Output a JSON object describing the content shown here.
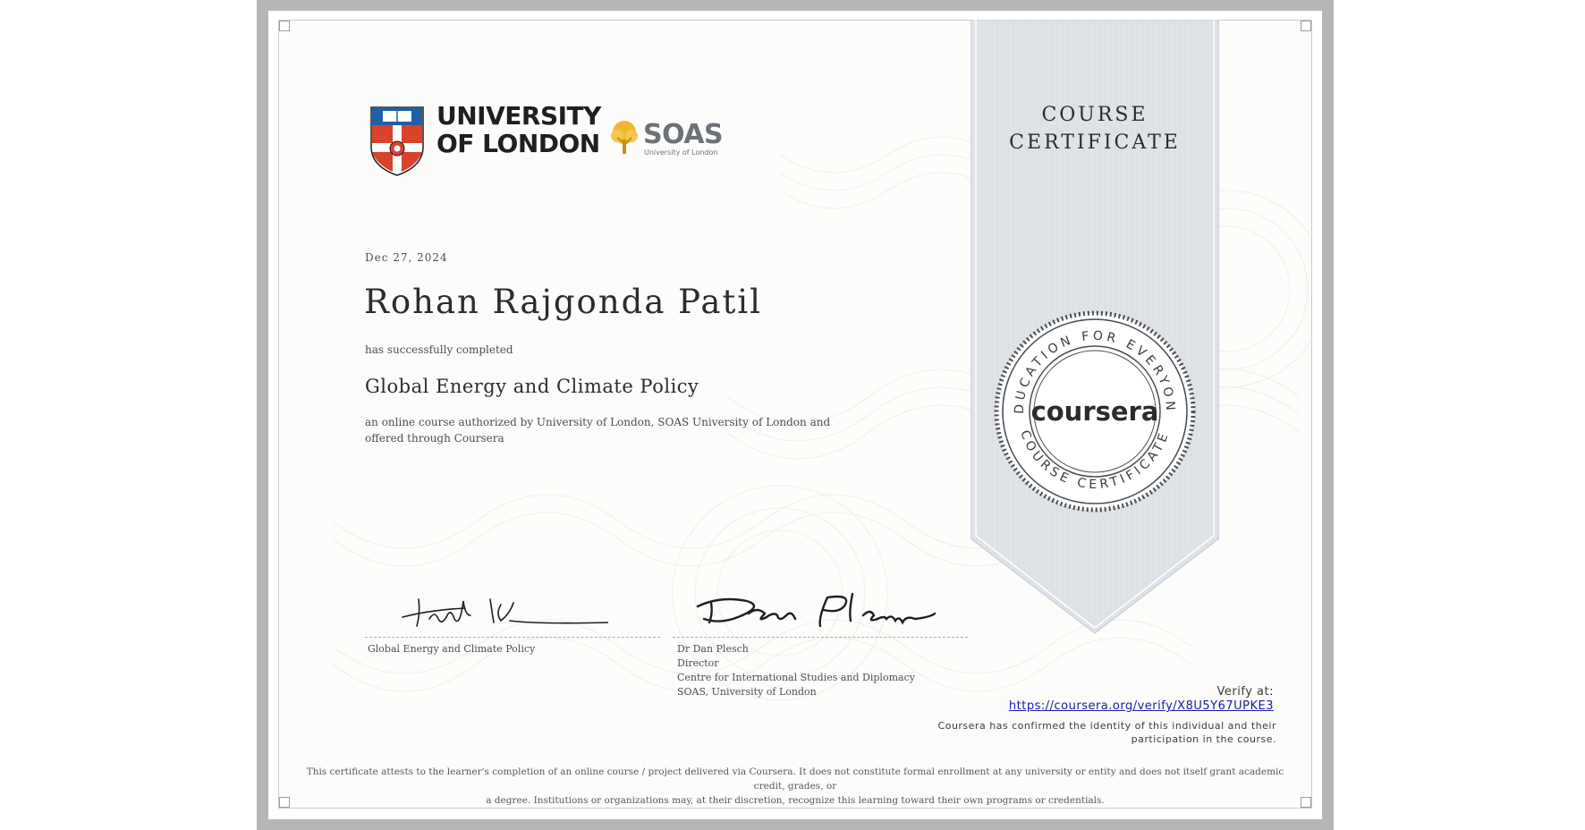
{
  "issuer": {
    "university_line1": "UNIVERSITY",
    "university_line2": "OF LONDON",
    "partner_name": "SOAS",
    "partner_subtitle": "University of London"
  },
  "certificate": {
    "date": "Dec 27, 2024",
    "recipient": "Rohan Rajgonda Patil",
    "completed_text": "has successfully completed",
    "course_title": "Global Energy and Climate Policy",
    "description": "an online course authorized by University of London, SOAS University of London and offered through Coursera",
    "ribbon_line1": "COURSE",
    "ribbon_line2": "CERTIFICATE"
  },
  "seal": {
    "brand": "coursera",
    "top_text": "EDUCATION FOR EVERYONE",
    "bottom_text": "COURSE CERTIFICATE"
  },
  "signatures": {
    "left": {
      "caption": "Global Energy and Climate Policy"
    },
    "right": {
      "name": "Dr Dan Plesch",
      "title": "Director",
      "department": "Centre for International Studies and Diplomacy",
      "institution": "SOAS, University of London"
    }
  },
  "verification": {
    "label": "Verify at:",
    "url": "https://coursera.org/verify/X8U5Y67UPKE3",
    "identity_line1": "Coursera has confirmed the identity of this individual and their",
    "identity_line2": "participation in the course."
  },
  "footer": {
    "disclaimer_line1": "This certificate attests to the learner's completion of an online course / project delivered via Coursera. It does not constitute formal enrollment at any university or entity and does not itself grant academic credit, grades, or",
    "disclaimer_line2": "a degree. Institutions or organizations may, at their discretion, recognize this learning toward their own programs or credentials."
  },
  "colors": {
    "frame": "#b4b6b8",
    "ribbon": "#dfe3e8",
    "shield_blue": "#1f5fa6",
    "shield_red": "#d9422b",
    "soas_gold": "#f0b82e",
    "link": "#1a1aa8"
  }
}
